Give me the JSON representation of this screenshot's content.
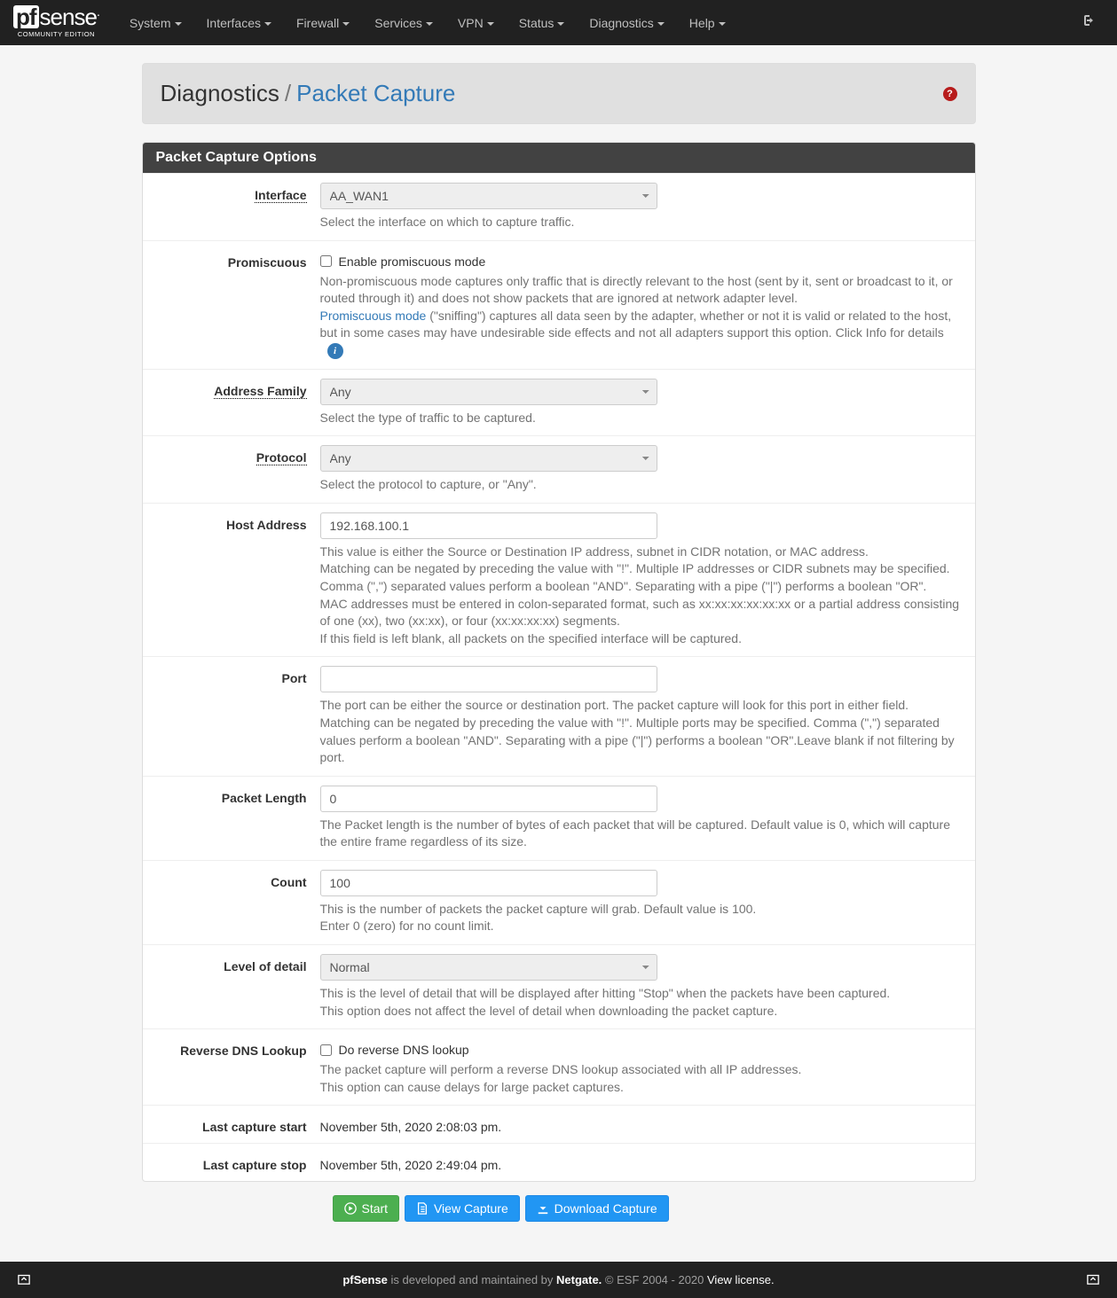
{
  "logo": {
    "brand1": "pf",
    "brand2": "sense",
    "edition": "COMMUNITY EDITION"
  },
  "nav": [
    "System",
    "Interfaces",
    "Firewall",
    "Services",
    "VPN",
    "Status",
    "Diagnostics",
    "Help"
  ],
  "breadcrumb": {
    "section": "Diagnostics",
    "page": "Packet Capture"
  },
  "panel_title": "Packet Capture Options",
  "labels": {
    "interface": "Interface",
    "promiscuous": "Promiscuous",
    "address_family": "Address Family",
    "protocol": "Protocol",
    "host": "Host Address",
    "port": "Port",
    "packet_length": "Packet Length",
    "count": "Count",
    "detail": "Level of detail",
    "reverse_dns": "Reverse DNS Lookup",
    "last_start": "Last capture start",
    "last_stop": "Last capture stop"
  },
  "values": {
    "interface": "AA_WAN1",
    "address_family": "Any",
    "protocol": "Any",
    "host": "192.168.100.1",
    "port": "",
    "packet_length": "0",
    "count": "100",
    "detail": "Normal",
    "last_start": "November 5th, 2020 2:08:03 pm.",
    "last_stop": "November 5th, 2020 2:49:04 pm."
  },
  "checkbox": {
    "promiscuous": "Enable promiscuous mode",
    "reverse_dns": "Do reverse DNS lookup"
  },
  "help": {
    "interface": "Select the interface on which to capture traffic.",
    "promiscuous1": "Non-promiscuous mode captures only traffic that is directly relevant to the host (sent by it, sent or broadcast to it, or routed through it) and does not show packets that are ignored at network adapter level.",
    "promiscuous_link": "Promiscuous mode",
    "promiscuous2": " (\"sniffing\") captures all data seen by the adapter, whether or not it is valid or related to the host, but in some cases may have undesirable side effects and not all adapters support this option. Click Info for details",
    "address_family": "Select the type of traffic to be captured.",
    "protocol": "Select the protocol to capture, or \"Any\".",
    "host1": "This value is either the Source or Destination IP address, subnet in CIDR notation, or MAC address.",
    "host2": "Matching can be negated by preceding the value with \"!\". Multiple IP addresses or CIDR subnets may be specified. Comma (\",\") separated values perform a boolean \"AND\". Separating with a pipe (\"|\") performs a boolean \"OR\".",
    "host3": "MAC addresses must be entered in colon-separated format, such as xx:xx:xx:xx:xx:xx or a partial address consisting of one (xx), two (xx:xx), or four (xx:xx:xx:xx) segments.",
    "host4": "If this field is left blank, all packets on the specified interface will be captured.",
    "port": "The port can be either the source or destination port. The packet capture will look for this port in either field. Matching can be negated by preceding the value with \"!\". Multiple ports may be specified. Comma (\",\") separated values perform a boolean \"AND\". Separating with a pipe (\"|\") performs a boolean \"OR\".Leave blank if not filtering by port.",
    "packet_length": "The Packet length is the number of bytes of each packet that will be captured. Default value is 0, which will capture the entire frame regardless of its size.",
    "count1": "This is the number of packets the packet capture will grab. Default value is 100.",
    "count2": "Enter 0 (zero) for no count limit.",
    "detail1": "This is the level of detail that will be displayed after hitting \"Stop\" when the packets have been captured.",
    "detail2": "This option does not affect the level of detail when downloading the packet capture.",
    "reverse1": "The packet capture will perform a reverse DNS lookup associated with all IP addresses.",
    "reverse2": "This option can cause delays for large packet captures."
  },
  "buttons": {
    "start": "Start",
    "view": "View Capture",
    "download": "Download Capture"
  },
  "footer": {
    "t1": "pfSense",
    "t2": " is developed and maintained by ",
    "t3": "Netgate.",
    "t4": " © ESF 2004 - 2020 ",
    "t5": "View license."
  }
}
